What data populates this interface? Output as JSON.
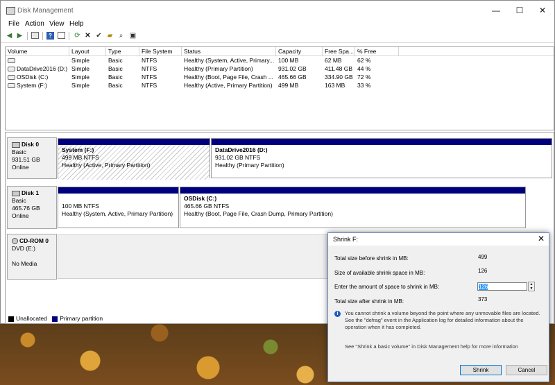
{
  "window": {
    "title": "Disk Management",
    "minimize": "—",
    "maximize": "☐",
    "close": "✕"
  },
  "menu": [
    "File",
    "Action",
    "View",
    "Help"
  ],
  "toolbar_icons": [
    "back-icon",
    "forward-icon",
    "console-icon",
    "help-icon",
    "properties-icon",
    "refresh-icon",
    "delete-icon",
    "check-icon",
    "open-icon",
    "search-icon",
    "rescan-icon"
  ],
  "volume_list": {
    "columns": [
      "Volume",
      "Layout",
      "Type",
      "File System",
      "Status",
      "Capacity",
      "Free Spa...",
      "% Free"
    ],
    "rows": [
      [
        "",
        "Simple",
        "Basic",
        "NTFS",
        "Healthy (System, Active, Primary...",
        "100 MB",
        "62 MB",
        "62 %"
      ],
      [
        "DataDrive2016 (D:)",
        "Simple",
        "Basic",
        "NTFS",
        "Healthy (Primary Partition)",
        "931.02 GB",
        "411.48 GB",
        "44 %"
      ],
      [
        "OSDisk (C:)",
        "Simple",
        "Basic",
        "NTFS",
        "Healthy (Boot, Page File, Crash ...",
        "465.66 GB",
        "334.90 GB",
        "72 %"
      ],
      [
        "System (F:)",
        "Simple",
        "Basic",
        "NTFS",
        "Healthy (Active, Primary Partition)",
        "499 MB",
        "163 MB",
        "33 %"
      ]
    ]
  },
  "disks": {
    "disk0": {
      "name": "Disk 0",
      "type": "Basic",
      "size": "931.51 GB",
      "state": "Online",
      "parts": [
        {
          "name": "System  (F:)",
          "size": "499 MB NTFS",
          "status": "Healthy (Active, Primary Partition)"
        },
        {
          "name": "DataDrive2016  (D:)",
          "size": "931.02 GB NTFS",
          "status": "Healthy (Primary Partition)"
        }
      ]
    },
    "disk1": {
      "name": "Disk 1",
      "type": "Basic",
      "size": "465.76 GB",
      "state": "Online",
      "parts": [
        {
          "size": "100 MB NTFS",
          "status": "Healthy (System, Active, Primary Partition)"
        },
        {
          "name": "OSDisk  (C:)",
          "size": "465.66 GB NTFS",
          "status": "Healthy (Boot, Page File, Crash Dump, Primary Partition)"
        }
      ]
    },
    "cdrom": {
      "name": "CD-ROM 0",
      "type": "DVD (E:)",
      "state": "No Media"
    }
  },
  "legend": {
    "unallocated": "Unallocated",
    "primary": "Primary partition",
    "unallocated_color": "#000000",
    "primary_color": "#00007f"
  },
  "dialog": {
    "title": "Shrink F:",
    "total_before_label": "Total size before shrink in MB:",
    "total_before_value": "499",
    "available_label": "Size of available shrink space in MB:",
    "available_value": "126",
    "amount_label": "Enter the amount of space to shrink in MB:",
    "amount_value": "126",
    "total_after_label": "Total size after shrink in MB:",
    "total_after_value": "373",
    "info": "You cannot shrink a volume beyond the point where any unmovable files are located. See the \"defrag\" event in the Application log for detailed information about the operation when it has completed.",
    "help": "See \"Shrink a basic volume\" in Disk Management help for more information",
    "shrink_button": "Shrink",
    "cancel_button": "Cancel"
  }
}
